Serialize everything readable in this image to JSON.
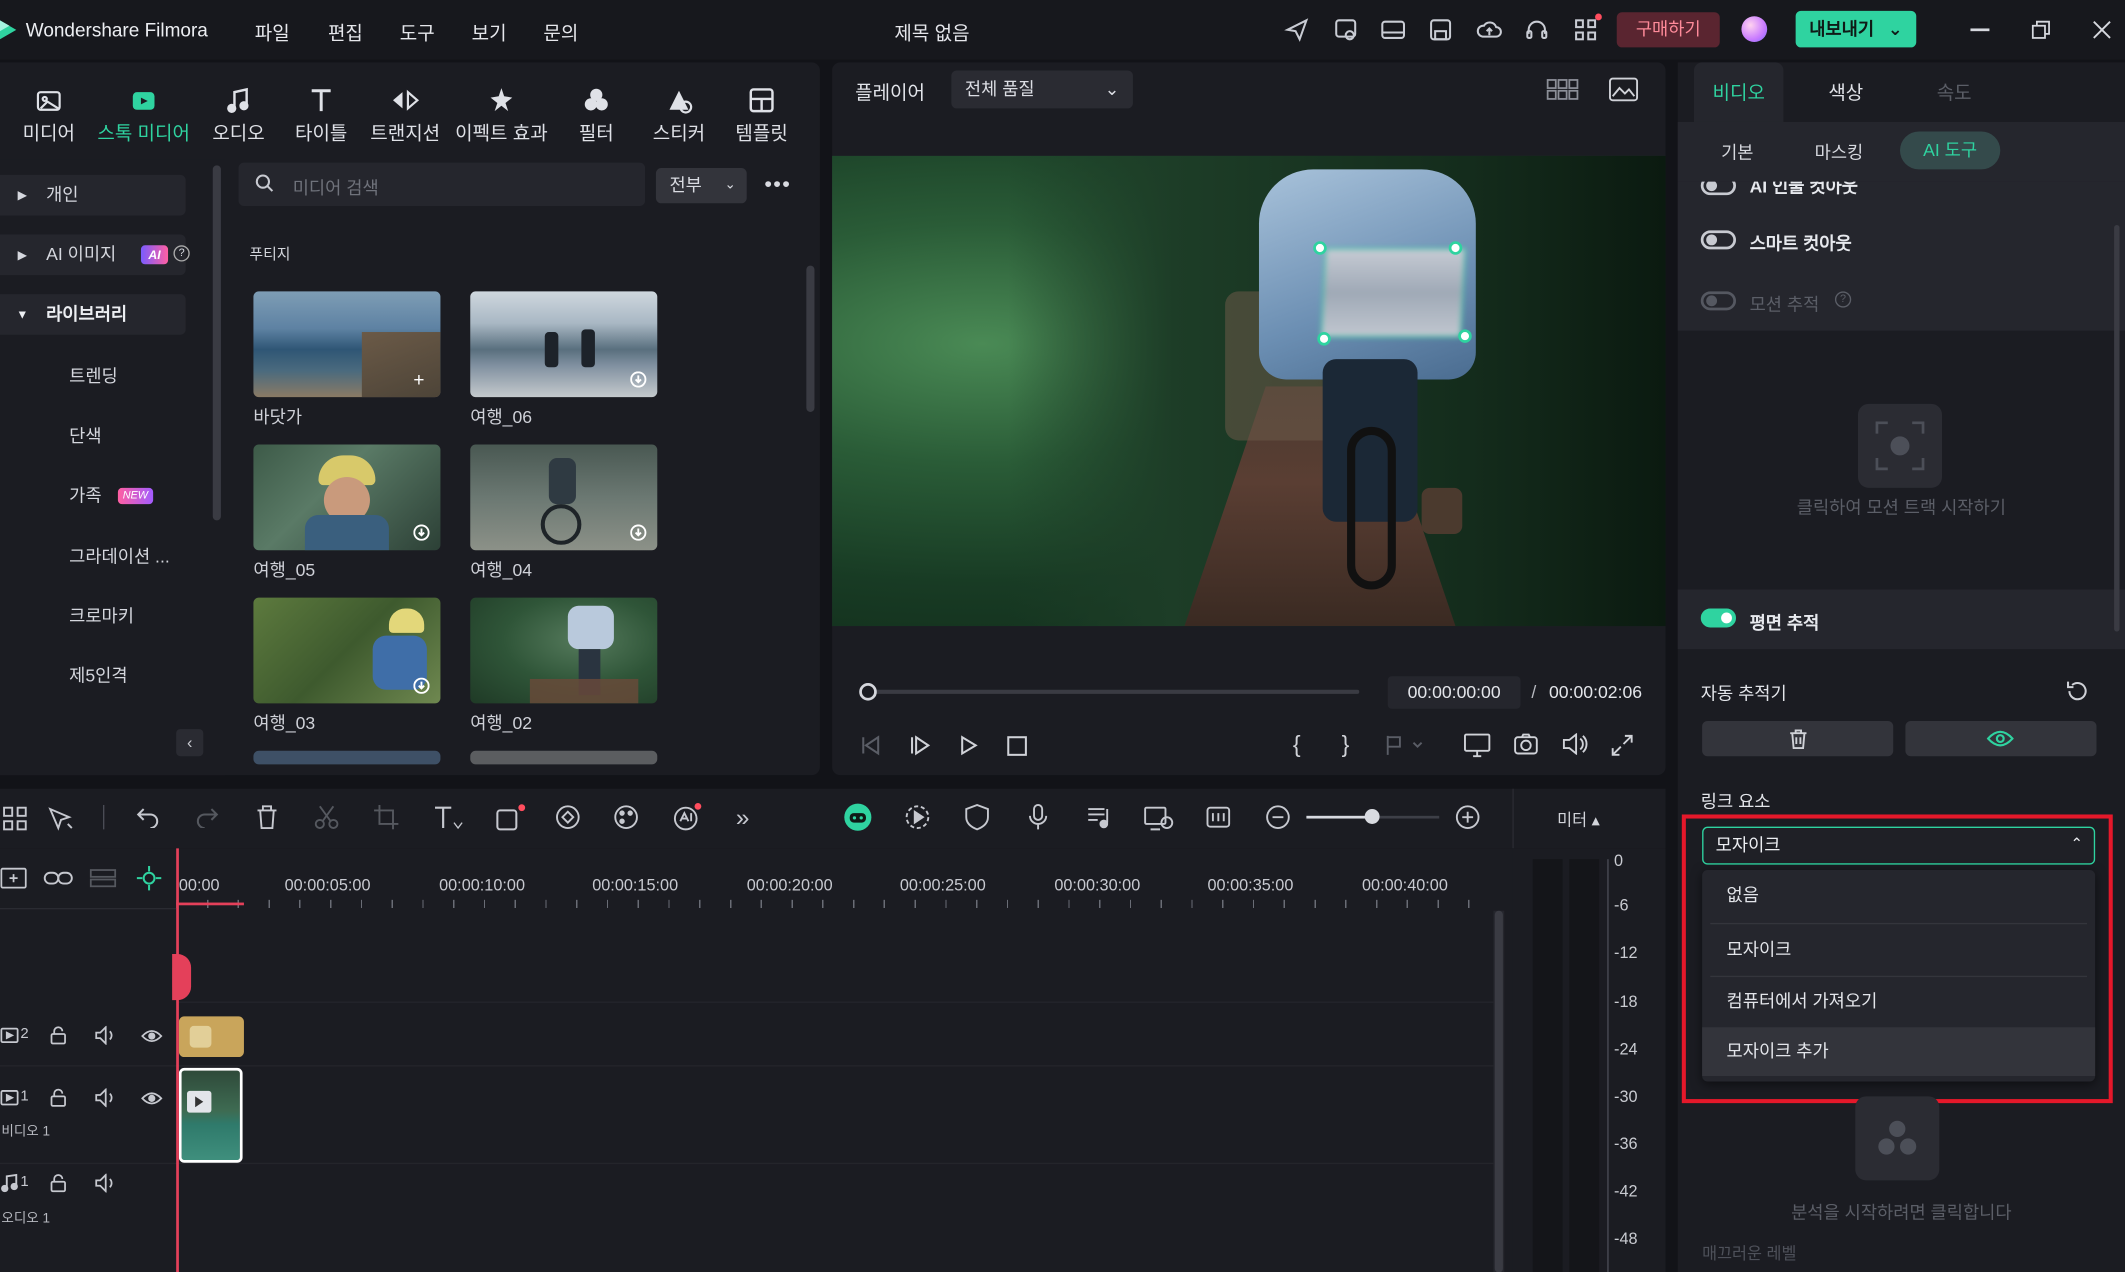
{
  "app": {
    "name": "Wondershare Filmora",
    "project_title": "제목 없음"
  },
  "menu": [
    "파일",
    "편집",
    "도구",
    "보기",
    "문의"
  ],
  "titlebar": {
    "buy_label": "구매하기",
    "export_label": "내보내기"
  },
  "media_tabs": [
    {
      "label": "미디어",
      "icon": "media-icon"
    },
    {
      "label": "스톡 미디어",
      "icon": "stock-media-icon",
      "active": true
    },
    {
      "label": "오디오",
      "icon": "music-note-icon"
    },
    {
      "label": "타이틀",
      "icon": "text-t-icon"
    },
    {
      "label": "트랜지션",
      "icon": "transition-icon"
    },
    {
      "label": "이펙트 효과",
      "icon": "effects-icon"
    },
    {
      "label": "필터",
      "icon": "filter-icon"
    },
    {
      "label": "스티커",
      "icon": "sticker-icon"
    },
    {
      "label": "템플릿",
      "icon": "template-icon"
    }
  ],
  "sidebar": {
    "items": [
      {
        "label": "개인",
        "expandable": true
      },
      {
        "label": "AI 이미지",
        "badge": "AI",
        "expandable": true
      },
      {
        "label": "라이브러리",
        "expanded": true
      },
      {
        "label": "트렌딩"
      },
      {
        "label": "단색"
      },
      {
        "label": "가족",
        "badge": "NEW"
      },
      {
        "label": "그라데이션 ..."
      },
      {
        "label": "크로마키"
      },
      {
        "label": "제5인격"
      }
    ]
  },
  "media_browser": {
    "search_placeholder": "미디어 검색",
    "filter_label": "전부",
    "section_title": "푸티지",
    "items": [
      {
        "label": "바닷가",
        "icon": "add-icon"
      },
      {
        "label": "여행_06",
        "icon": "download-icon"
      },
      {
        "label": "여행_05",
        "icon": "download-icon"
      },
      {
        "label": "여행_04",
        "icon": "download-icon"
      },
      {
        "label": "여행_03",
        "icon": "download-icon"
      },
      {
        "label": "여행_02",
        "icon": "none"
      }
    ]
  },
  "player": {
    "label": "플레이어",
    "quality": "전체 품질",
    "current_time": "00:00:00:00",
    "separator": "/",
    "total_time": "00:00:02:06"
  },
  "right_panel": {
    "tabs": [
      {
        "label": "비디오",
        "active": true
      },
      {
        "label": "색상"
      },
      {
        "label": "속도",
        "disabled": true
      }
    ],
    "subtabs": [
      {
        "label": "기본"
      },
      {
        "label": "마스킹"
      },
      {
        "label": "AI 도구",
        "active": true
      }
    ],
    "ai_cutout_partial": "AI 인물 컷아웃",
    "smart_cutout": "스마트 컷아웃",
    "motion_tracking": "모션 추적",
    "motion_hint": "클릭하여 모션 트랙 시작하기",
    "planar_tracking": "평면 추적",
    "auto_tracker": "자동 추적기",
    "link_element": "링크 요소",
    "dropdown_value": "모자이크",
    "dropdown_options": [
      "없음",
      "모자이크",
      "컴퓨터에서 가져오기",
      "모자이크 추가"
    ],
    "analysis_hint": "분석을 시작하려면 클릭합니다",
    "smooth_level": "매끄러운 레벨"
  },
  "timeline": {
    "ticks": [
      "00:00",
      "00:00:05:00",
      "00:00:10:00",
      "00:00:15:00",
      "00:00:20:00",
      "00:00:25:00",
      "00:00:30:00",
      "00:00:35:00",
      "00:00:40:00"
    ],
    "meter_label": "미터",
    "meter_scale": [
      "0",
      "-6",
      "-12",
      "-18",
      "-24",
      "-30",
      "-36",
      "-42",
      "-48"
    ],
    "tracks": [
      {
        "num": "2",
        "name": ""
      },
      {
        "num": "1",
        "name": "비디오 1"
      },
      {
        "num": "1",
        "name": "오디오 1"
      }
    ]
  },
  "colors": {
    "accent": "#2fd3a0",
    "highlight_box": "#e5182a",
    "playhead": "#e4405a",
    "buy_bg": "#5a2530",
    "export_bg": "#2fd3a0"
  }
}
